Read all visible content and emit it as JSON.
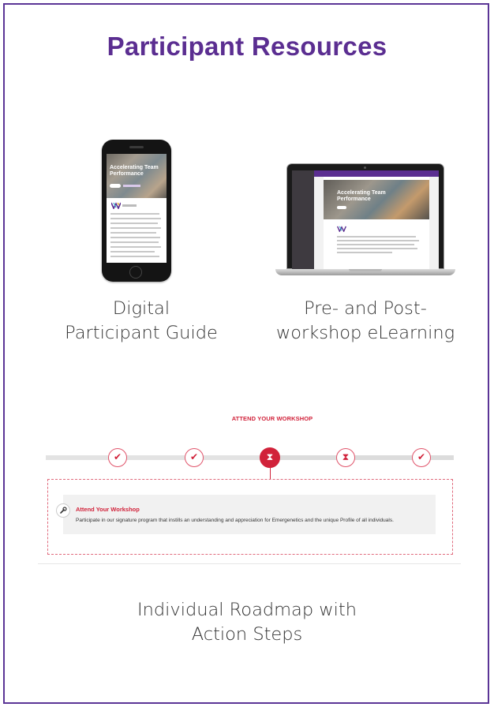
{
  "page": {
    "title": "Participant Resources"
  },
  "resources": [
    {
      "caption_line1": "Digital",
      "caption_line2": "Participant Guide"
    },
    {
      "caption_line1": "Pre- and Post-",
      "caption_line2": "workshop eLearning"
    },
    {
      "caption_line1": "Individual Roadmap with",
      "caption_line2": "Action Steps"
    }
  ],
  "phone_screen": {
    "hero_title": "Accelerating Team Performance"
  },
  "laptop_screen": {
    "hero_title": "Accelerating Team Performance"
  },
  "roadmap": {
    "active_label": "ATTEND YOUR WORKSHOP",
    "steps": [
      {
        "icon": "check-icon",
        "glyph": "✔",
        "state": "complete"
      },
      {
        "icon": "check-icon",
        "glyph": "✔",
        "state": "complete"
      },
      {
        "icon": "hourglass-icon",
        "glyph": "⧗",
        "state": "active"
      },
      {
        "icon": "hourglass-icon",
        "glyph": "⧗",
        "state": "pending"
      },
      {
        "icon": "check-icon",
        "glyph": "✔",
        "state": "complete"
      }
    ],
    "detail_title": "Attend Your Workshop",
    "detail_description": "Participate in our signature program that instills an understanding and appreciation for Emergenetics and the unique Profile of all individuals.",
    "detail_icon": "wrench-icon"
  },
  "colors": {
    "title": "#5b2e91",
    "frame": "#5b3596",
    "accent_red": "#d1223a"
  }
}
